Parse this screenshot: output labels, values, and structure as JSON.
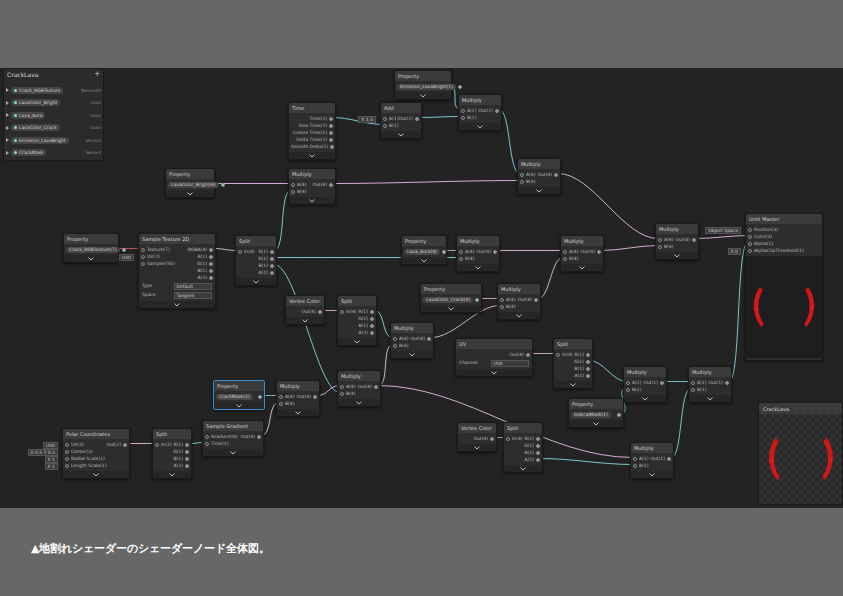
{
  "caption": "▲地割れシェーダーのシェーダーノード全体図。",
  "blackboard": {
    "title": "CrackLava",
    "add": "+",
    "items": [
      {
        "name": "Crack_RGBTexture",
        "type": "Texture2D"
      },
      {
        "name": "LavaColor_Bright",
        "type": "Color"
      },
      {
        "name": "Lava_Aura",
        "type": "Color"
      },
      {
        "name": "LavaColor_Crack",
        "type": "Color"
      },
      {
        "name": "Emission_LavaBright",
        "type": "Vector1"
      },
      {
        "name": "CrackMask",
        "type": "Vector1"
      }
    ]
  },
  "preview_window": {
    "title": "CrackLava"
  },
  "nodes": [
    {
      "kind": "property",
      "title": "Property",
      "selected": false,
      "inputs": [],
      "outputs": [
        "Emission_LavaBright(1)"
      ],
      "fields": []
    },
    {
      "kind": "node",
      "title": "Time",
      "selected": false,
      "inputs": [],
      "outputs": [
        "Time(1)",
        "Sine Time(1)",
        "Cosine Time(1)",
        "Delta Time(1)",
        "Smooth Delta(1)"
      ],
      "fields": []
    },
    {
      "kind": "node",
      "title": "Add",
      "selected": false,
      "inputs": [
        {
          "label": "A(1)",
          "value": "X 1.5"
        },
        {
          "label": "B(1)"
        }
      ],
      "outputs": [
        "Out(1)"
      ],
      "fields": []
    },
    {
      "kind": "node",
      "title": "Multiply",
      "selected": false,
      "inputs": [
        {
          "label": "A(1)"
        },
        {
          "label": "B(1)"
        }
      ],
      "outputs": [
        "Out(1)"
      ],
      "fields": []
    },
    {
      "kind": "node",
      "title": "Multiply",
      "selected": false,
      "inputs": [
        {
          "label": "A(4)"
        },
        {
          "label": "B(4)"
        }
      ],
      "outputs": [
        "Out(4)"
      ],
      "fields": []
    },
    {
      "kind": "property",
      "title": "Property",
      "selected": false,
      "inputs": [],
      "outputs": [
        "LavaColor_Bright(4)"
      ],
      "fields": []
    },
    {
      "kind": "node",
      "title": "Multiply",
      "selected": false,
      "inputs": [
        {
          "label": "A(4)"
        },
        {
          "label": "B(4)"
        }
      ],
      "outputs": [
        "Out(4)"
      ],
      "fields": []
    },
    {
      "kind": "property",
      "title": "Property",
      "selected": false,
      "inputs": [],
      "outputs": [
        "Crack_RGBTexture(T)"
      ],
      "fields": []
    },
    {
      "kind": "node",
      "title": "Sample Texture 2D",
      "selected": false,
      "inputs": [
        {
          "label": "Texture(T)"
        },
        {
          "label": "UV(2)",
          "value": "UV0"
        },
        {
          "label": "Sampler(SS)"
        }
      ],
      "outputs": [
        "RGBA(4)",
        "R(1)",
        "G(1)",
        "B(1)",
        "A(1)"
      ],
      "fields": [
        {
          "label": "Type",
          "value": "Default"
        },
        {
          "label": "Space",
          "value": "Tangent"
        }
      ]
    },
    {
      "kind": "node",
      "title": "Split",
      "selected": false,
      "inputs": [
        {
          "label": "In(4)"
        }
      ],
      "outputs": [
        "R(1)",
        "G(1)",
        "B(1)",
        "A(1)"
      ],
      "fields": []
    },
    {
      "kind": "property",
      "title": "Property",
      "selected": false,
      "inputs": [],
      "outputs": [
        "Lava_Aura(4)"
      ],
      "fields": []
    },
    {
      "kind": "node",
      "title": "Multiply",
      "selected": false,
      "inputs": [
        {
          "label": "A(4)"
        },
        {
          "label": "B(4)"
        }
      ],
      "outputs": [
        "Out(4)"
      ],
      "fields": []
    },
    {
      "kind": "node",
      "title": "Multiply",
      "selected": false,
      "inputs": [
        {
          "label": "A(4)"
        },
        {
          "label": "B(4)"
        }
      ],
      "outputs": [
        "Out(4)"
      ],
      "fields": []
    },
    {
      "kind": "node",
      "title": "Multiply",
      "selected": false,
      "inputs": [
        {
          "label": "A(4)"
        },
        {
          "label": "B(4)"
        }
      ],
      "outputs": [
        "Out(4)"
      ],
      "fields": []
    },
    {
      "kind": "master",
      "title": "Unlit Master",
      "selected": false,
      "inputs": [
        {
          "label": "Position(3)",
          "value": "Object Space"
        },
        {
          "label": "Color(3)"
        },
        {
          "label": "Alpha(1)"
        },
        {
          "label": "AlphaClipThreshold(1)",
          "value": "X 0"
        }
      ],
      "outputs": [],
      "fields": []
    },
    {
      "kind": "node",
      "title": "Vertex Color",
      "selected": false,
      "inputs": [],
      "outputs": [
        "Out(4)"
      ],
      "fields": []
    },
    {
      "kind": "node",
      "title": "Split",
      "selected": false,
      "inputs": [
        {
          "label": "In(4)"
        }
      ],
      "outputs": [
        "R(1)",
        "G(1)",
        "B(1)",
        "A(1)"
      ],
      "fields": []
    },
    {
      "kind": "property",
      "title": "Property",
      "selected": false,
      "inputs": [],
      "outputs": [
        "LavaColor_Crack(4)"
      ],
      "fields": []
    },
    {
      "kind": "node",
      "title": "Multiply",
      "selected": false,
      "inputs": [
        {
          "label": "A(4)"
        },
        {
          "label": "B(4)"
        }
      ],
      "outputs": [
        "Out(4)"
      ],
      "fields": []
    },
    {
      "kind": "node",
      "title": "Multiply",
      "selected": false,
      "inputs": [
        {
          "label": "A(4)"
        },
        {
          "label": "B(4)"
        }
      ],
      "outputs": [
        "Out(4)"
      ],
      "fields": []
    },
    {
      "kind": "node",
      "title": "UV",
      "selected": false,
      "inputs": [],
      "outputs": [
        "Out(4)"
      ],
      "fields": [
        {
          "label": "Channel",
          "value": "UV0"
        }
      ]
    },
    {
      "kind": "node",
      "title": "Split",
      "selected": false,
      "inputs": [
        {
          "label": "In(4)"
        }
      ],
      "outputs": [
        "R(1)",
        "G(1)",
        "B(1)",
        "A(1)"
      ],
      "fields": []
    },
    {
      "kind": "node",
      "title": "Multiply",
      "selected": false,
      "inputs": [
        {
          "label": "A(1)"
        },
        {
          "label": "B(1)"
        }
      ],
      "outputs": [
        "Out(1)"
      ],
      "fields": []
    },
    {
      "kind": "node",
      "title": "Multiply",
      "selected": false,
      "inputs": [
        {
          "label": "A(1)"
        },
        {
          "label": "B(1)"
        }
      ],
      "outputs": [
        "Out(1)"
      ],
      "fields": []
    },
    {
      "kind": "property",
      "title": "Property",
      "selected": true,
      "inputs": [],
      "outputs": [
        "CrackMask(1)"
      ],
      "fields": []
    },
    {
      "kind": "node",
      "title": "Multiply",
      "selected": false,
      "inputs": [
        {
          "label": "A(4)"
        },
        {
          "label": "B(4)"
        }
      ],
      "outputs": [
        "Out(4)"
      ],
      "fields": []
    },
    {
      "kind": "node",
      "title": "Multiply",
      "selected": false,
      "inputs": [
        {
          "label": "A(4)"
        },
        {
          "label": "B(4)"
        }
      ],
      "outputs": [
        "Out(4)"
      ],
      "fields": []
    },
    {
      "kind": "property",
      "title": "Property",
      "selected": false,
      "inputs": [],
      "outputs": [
        "IsdecalMask(1)"
      ],
      "fields": []
    },
    {
      "kind": "node",
      "title": "Polar Coordinates",
      "selected": false,
      "inputs": [
        {
          "label": "UV(2)",
          "value": "UV0"
        },
        {
          "label": "Center(2)",
          "value": "X 0.5 Y 0.5"
        },
        {
          "label": "Radial Scale(1)",
          "value": "X 1"
        },
        {
          "label": "Length Scale(1)",
          "value": "X 1"
        }
      ],
      "outputs": [
        "Out(2)"
      ],
      "fields": []
    },
    {
      "kind": "node",
      "title": "Split",
      "selected": false,
      "inputs": [
        {
          "label": "In(2)"
        }
      ],
      "outputs": [
        "R(1)",
        "G(1)",
        "B(1)",
        "A(1)"
      ],
      "fields": []
    },
    {
      "kind": "node",
      "title": "Sample Gradient",
      "selected": false,
      "inputs": [
        {
          "label": "Gradient(G)"
        },
        {
          "label": "Time(1)"
        }
      ],
      "outputs": [
        "Out(4)"
      ],
      "fields": []
    },
    {
      "kind": "node",
      "title": "Vertex Color",
      "selected": false,
      "inputs": [],
      "outputs": [
        "Out(4)"
      ],
      "fields": []
    },
    {
      "kind": "node",
      "title": "Split",
      "selected": false,
      "inputs": [
        {
          "label": "In(4)"
        }
      ],
      "outputs": [
        "R(1)",
        "G(1)",
        "B(1)",
        "A(1)"
      ],
      "fields": []
    },
    {
      "kind": "node",
      "title": "Multiply",
      "selected": false,
      "inputs": [
        {
          "label": "A(1)"
        },
        {
          "label": "B(1)"
        }
      ],
      "outputs": [
        "Out(1)"
      ],
      "fields": []
    }
  ]
}
